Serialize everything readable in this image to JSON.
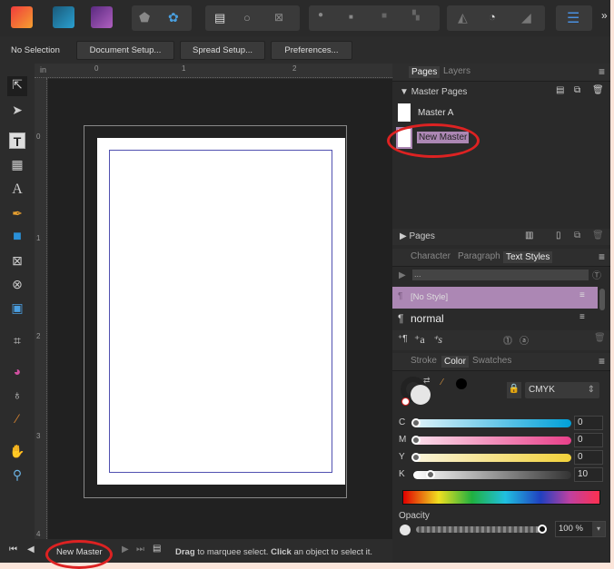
{
  "toolbar": {
    "apps": [
      "publisher",
      "designer",
      "photo"
    ],
    "no_selection": "No Selection",
    "document_setup": "Document Setup...",
    "spread_setup": "Spread Setup...",
    "preferences": "Preferences...",
    "more": "»"
  },
  "ruler": {
    "unit": "in",
    "h_ticks": [
      "0",
      "1",
      "2"
    ],
    "v_ticks": [
      "0",
      "1",
      "2",
      "3",
      "4"
    ]
  },
  "tools": [
    "move-tool",
    "node-tool",
    "frame-text-tool",
    "table-tool",
    "artistic-text-tool",
    "pen-tool",
    "rectangle-tool",
    "picture-frame-rect-tool",
    "picture-frame-ellipse-tool",
    "place-image-tool",
    "crop-tool",
    "fill-tool",
    "transparency-tool",
    "color-picker-tool",
    "view-tool",
    "zoom-tool"
  ],
  "pages_panel": {
    "tabs": [
      "Pages",
      "Layers"
    ],
    "active_tab": "Pages",
    "master_section": "Master Pages",
    "masters": [
      "Master A",
      "New Master"
    ],
    "selected_master": "New Master",
    "pages_section": "Pages"
  },
  "text_panel": {
    "tabs": [
      "Character",
      "Paragraph",
      "Text Styles"
    ],
    "active_tab": "Text Styles",
    "filter": "...",
    "styles": [
      "[No Style]",
      "normal"
    ],
    "selected_style": "[No Style]"
  },
  "color_panel": {
    "tabs": [
      "Stroke",
      "Color",
      "Swatches"
    ],
    "active_tab": "Color",
    "model": "CMYK",
    "channels": [
      {
        "label": "C",
        "value": "0",
        "color": "#00a0d8"
      },
      {
        "label": "M",
        "value": "0",
        "color": "#e8408a"
      },
      {
        "label": "Y",
        "value": "0",
        "color": "#f2d23a"
      },
      {
        "label": "K",
        "value": "10",
        "color": "#333333"
      }
    ],
    "opacity_label": "Opacity",
    "opacity": "100 %"
  },
  "status": {
    "page_name": "New Master",
    "hint_b1": "Drag",
    "hint_t1": " to marquee select. ",
    "hint_b2": "Click",
    "hint_t2": " an object to select it."
  },
  "colors": {
    "accent_selection": "#ac87b4",
    "annotation": "#d22222",
    "margin_guide": "#5050b0"
  }
}
